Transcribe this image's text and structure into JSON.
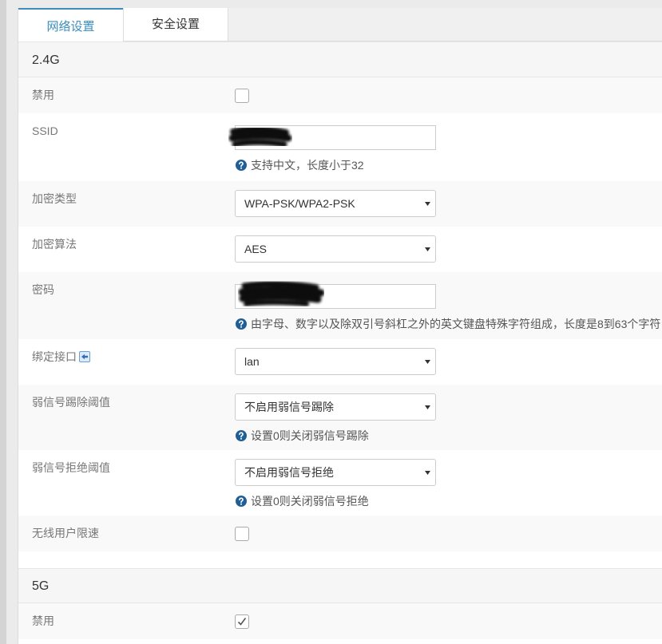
{
  "tabs": [
    {
      "label": "网络设置",
      "active": true
    },
    {
      "label": "安全设置",
      "active": false
    }
  ],
  "band_24g": {
    "title": "2.4G",
    "disable": {
      "label": "禁用",
      "checked": false
    },
    "ssid": {
      "label": "SSID",
      "value": "",
      "hint": "支持中文，长度小于32",
      "redacted": true
    },
    "encryption_type": {
      "label": "加密类型",
      "selected": "WPA-PSK/WPA2-PSK"
    },
    "encryption_algorithm": {
      "label": "加密算法",
      "selected": "AES"
    },
    "password": {
      "label": "密码",
      "value": "",
      "hint": "由字母、数字以及除双引号斜杠之外的英文键盘特殊字符组成，长度是8到63个字符",
      "redacted": true
    },
    "bind_interface": {
      "label": "绑定接口",
      "selected": "lan",
      "icon": "interface-link-icon"
    },
    "weak_signal_kick": {
      "label": "弱信号踢除阈值",
      "selected": "不启用弱信号踢除",
      "hint": "设置0则关闭弱信号踢除"
    },
    "weak_signal_reject": {
      "label": "弱信号拒绝阈值",
      "selected": "不启用弱信号拒绝",
      "hint": "设置0则关闭弱信号拒绝"
    },
    "rate_limit": {
      "label": "无线用户限速",
      "checked": false
    }
  },
  "band_5g": {
    "title": "5G",
    "disable": {
      "label": "禁用",
      "checked": true
    }
  },
  "icons": {
    "hint": "question-circle-icon",
    "select_arrow": "caret-down-icon",
    "checkbox_mark": "check-icon"
  },
  "colors": {
    "accent": "#3c8dbc",
    "hint_icon": "#1f5f96",
    "label": "#777777",
    "row_alt": "#f9f9f9"
  }
}
